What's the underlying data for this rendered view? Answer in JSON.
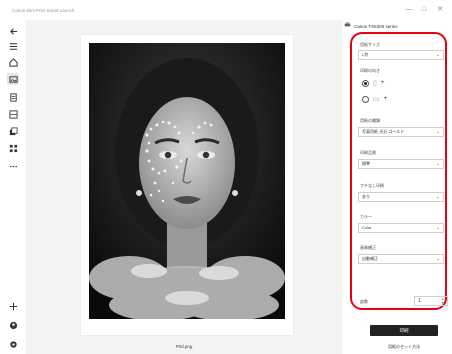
{
  "app": {
    "title": "Canon Mini Print Smart Launch",
    "window_minimize": "—",
    "window_maximize": "□",
    "window_close": "✕"
  },
  "canvas": {
    "file_name": "P0d.png"
  },
  "panel": {
    "printer": {
      "icon": "printer-icon",
      "name": "Canon TS5300 series"
    },
    "paper_size": {
      "label": "用紙サイズ",
      "value": "L判"
    },
    "orientation": {
      "label": "印刷の向き",
      "portrait_plus": "+",
      "landscape_plus": "+"
    },
    "paper_type": {
      "label": "用紙の種類",
      "value": "写真用紙 光沢 ゴールド"
    },
    "print_quality": {
      "label": "印刷品質",
      "value": "標準"
    },
    "borderless": {
      "label": "フチなし印刷",
      "value": "あり"
    },
    "color": {
      "label": "カラー",
      "value": "Color"
    },
    "correction": {
      "label": "画像補正",
      "value": "自動補正"
    },
    "copies": {
      "label": "部数",
      "value": "1",
      "up": "▲",
      "down": "▼"
    },
    "print_button": "印刷",
    "reset_link": "用紙のセット方法"
  },
  "accent_color": "#e60012"
}
